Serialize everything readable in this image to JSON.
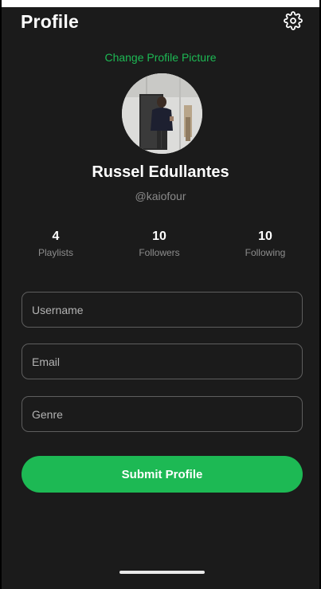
{
  "header": {
    "title": "Profile",
    "settings_icon": "gear-icon"
  },
  "profile": {
    "change_picture_label": "Change Profile Picture",
    "name": "Russel Edullantes",
    "handle": "@kaiofour"
  },
  "stats": [
    {
      "value": "4",
      "label": "Playlists"
    },
    {
      "value": "10",
      "label": "Followers"
    },
    {
      "value": "10",
      "label": "Following"
    }
  ],
  "form": {
    "username_placeholder": "Username",
    "email_placeholder": "Email",
    "genre_placeholder": "Genre",
    "submit_label": "Submit Profile"
  },
  "colors": {
    "accent": "#1db954",
    "background": "#1b1b1b"
  }
}
